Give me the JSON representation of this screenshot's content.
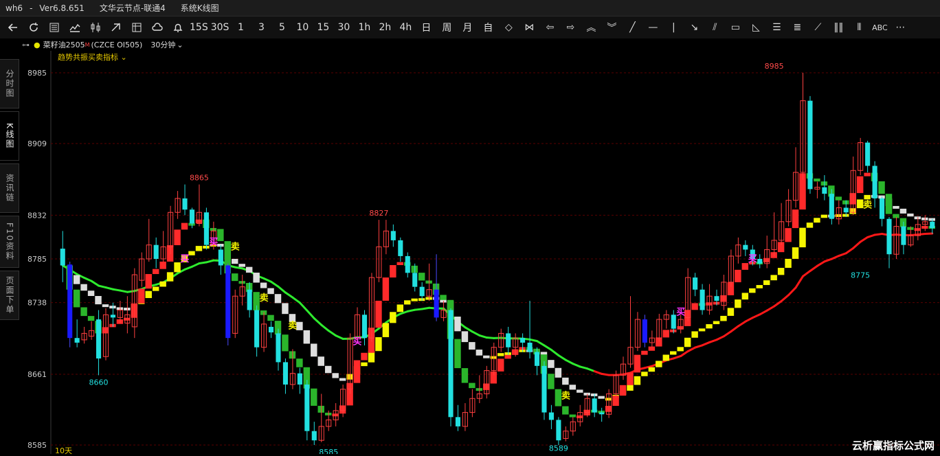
{
  "titlebar": {
    "app": "wh6",
    "sep": "-",
    "version": "Ver6.8.651",
    "node": "文华云节点-联通4",
    "view": "系统K线图"
  },
  "toolbar": {
    "icons": [
      "back-arrow-icon",
      "refresh-icon",
      "table-icon",
      "line-chart-icon",
      "kline-icon",
      "draw-icon",
      "grid-icon",
      "cloud-icon",
      "bell-icon"
    ],
    "periods": [
      "15S",
      "30S",
      "1",
      "3",
      "5",
      "10",
      "15",
      "30",
      "1h",
      "2h",
      "4h",
      "日",
      "周",
      "月",
      "自"
    ],
    "tools": [
      "diamond-icon",
      "bowtie-icon",
      "arrow-left-icon",
      "arrow-right-icon",
      "double-up-icon",
      "double-down-icon",
      "slash-line-icon",
      "horizontal-line-icon",
      "vertical-line-icon",
      "arrow-down-right-icon",
      "parallel-lines-icon",
      "rectangle-icon",
      "triangle-icon",
      "fibonacci-icon",
      "gann-icon",
      "zigzag-icon",
      "bars-icon",
      "bars-dashed-icon"
    ],
    "text_tool": "ABC",
    "more": "more-icon"
  },
  "infobar": {
    "symbol": "菜籽油2505",
    "sup": "M",
    "code": "(CZCE OI505)",
    "period": "30分钟"
  },
  "indicator": "趋势共振买卖指标",
  "sidebar": [
    {
      "label": "分时图"
    },
    {
      "label": "K线图"
    },
    {
      "label": "资讯链"
    },
    {
      "label": "F10资料"
    },
    {
      "label": "页面下单"
    }
  ],
  "days_label": "10天",
  "watermark": "云析赢指标公式网",
  "chart_data": {
    "type": "candlestick",
    "ylim": [
      8585,
      8985
    ],
    "yticks": [
      8985,
      8909,
      8832,
      8785,
      8738,
      8661,
      8585
    ],
    "colors": {
      "up": "#ff2a2a",
      "down": "#22e0e0",
      "buy": "#ff33ff",
      "sell": "#f5f500",
      "grid": "#5a0000",
      "green_line": "#2eea2e",
      "red_line": "#ff1818",
      "yellow": "#f5f500",
      "blue": "#1a1aff"
    },
    "annotations": [
      {
        "i": 5,
        "text": "8660",
        "price": 8660,
        "pos": "below"
      },
      {
        "i": 19,
        "text": "8865",
        "price": 8865,
        "pos": "above"
      },
      {
        "i": 37,
        "text": "8585",
        "price": 8585,
        "pos": "below"
      },
      {
        "i": 44,
        "text": "8827",
        "price": 8827,
        "pos": "above"
      },
      {
        "i": 69,
        "text": "8589",
        "price": 8589,
        "pos": "below"
      },
      {
        "i": 99,
        "text": "8985",
        "price": 8985,
        "pos": "above"
      },
      {
        "i": 111,
        "text": "8775",
        "price": 8775,
        "pos": "below"
      }
    ],
    "signals": [
      {
        "i": 17,
        "text": "买",
        "price": 8782,
        "type": "buy"
      },
      {
        "i": 21,
        "text": "买",
        "price": 8800,
        "type": "buy"
      },
      {
        "i": 24,
        "text": "卖",
        "price": 8795,
        "type": "sell"
      },
      {
        "i": 28,
        "text": "卖",
        "price": 8740,
        "type": "sell"
      },
      {
        "i": 32,
        "text": "卖",
        "price": 8710,
        "type": "sell"
      },
      {
        "i": 41,
        "text": "买",
        "price": 8693,
        "type": "buy"
      },
      {
        "i": 70,
        "text": "卖",
        "price": 8635,
        "type": "sell"
      },
      {
        "i": 86,
        "text": "买",
        "price": 8725,
        "type": "buy"
      },
      {
        "i": 96,
        "text": "买",
        "price": 8782,
        "type": "buy"
      },
      {
        "i": 112,
        "text": "卖",
        "price": 8840,
        "type": "sell"
      }
    ],
    "candles": [
      {
        "o": 8796,
        "c": 8778,
        "h": 8815,
        "l": 8760
      },
      {
        "o": 8779,
        "c": 8700,
        "h": 8782,
        "l": 8690,
        "b": 1
      },
      {
        "o": 8700,
        "c": 8695,
        "h": 8720,
        "l": 8690
      },
      {
        "o": 8698,
        "c": 8705,
        "h": 8712,
        "l": 8694
      },
      {
        "o": 8702,
        "c": 8708,
        "h": 8718,
        "l": 8698
      },
      {
        "o": 8720,
        "c": 8678,
        "h": 8730,
        "l": 8660
      },
      {
        "o": 8680,
        "c": 8725,
        "h": 8732,
        "l": 8676
      },
      {
        "o": 8725,
        "c": 8722,
        "h": 8738,
        "l": 8712
      },
      {
        "o": 8722,
        "c": 8730,
        "h": 8740,
        "l": 8716
      },
      {
        "o": 8716,
        "c": 8725,
        "h": 8745,
        "l": 8705
      },
      {
        "o": 8712,
        "c": 8768,
        "h": 8775,
        "l": 8700
      },
      {
        "o": 8762,
        "c": 8785,
        "h": 8792,
        "l": 8755
      },
      {
        "o": 8785,
        "c": 8800,
        "h": 8828,
        "l": 8782
      },
      {
        "o": 8800,
        "c": 8785,
        "h": 8808,
        "l": 8775
      },
      {
        "o": 8785,
        "c": 8798,
        "h": 8815,
        "l": 8782
      },
      {
        "o": 8798,
        "c": 8835,
        "h": 8842,
        "l": 8790
      },
      {
        "o": 8835,
        "c": 8850,
        "h": 8858,
        "l": 8828
      },
      {
        "o": 8850,
        "c": 8838,
        "h": 8865,
        "l": 8832
      },
      {
        "o": 8838,
        "c": 8823,
        "h": 8840,
        "l": 8818
      },
      {
        "o": 8823,
        "c": 8835,
        "h": 8865,
        "l": 8820
      },
      {
        "o": 8835,
        "c": 8800,
        "h": 8840,
        "l": 8795
      },
      {
        "o": 8800,
        "c": 8815,
        "h": 8825,
        "l": 8795
      },
      {
        "o": 8795,
        "c": 8778,
        "h": 8800,
        "l": 8768
      },
      {
        "o": 8778,
        "c": 8700,
        "h": 8780,
        "l": 8692,
        "b": 1
      },
      {
        "o": 8705,
        "c": 8745,
        "h": 8752,
        "l": 8700
      },
      {
        "o": 8745,
        "c": 8755,
        "h": 8768,
        "l": 8735
      },
      {
        "o": 8752,
        "c": 8730,
        "h": 8760,
        "l": 8722
      },
      {
        "o": 8730,
        "c": 8690,
        "h": 8735,
        "l": 8680
      },
      {
        "o": 8690,
        "c": 8715,
        "h": 8728,
        "l": 8685
      },
      {
        "o": 8712,
        "c": 8706,
        "h": 8718,
        "l": 8700
      },
      {
        "o": 8705,
        "c": 8674,
        "h": 8710,
        "l": 8665
      },
      {
        "o": 8674,
        "c": 8650,
        "h": 8678,
        "l": 8640
      },
      {
        "o": 8650,
        "c": 8662,
        "h": 8688,
        "l": 8645
      },
      {
        "o": 8662,
        "c": 8650,
        "h": 8668,
        "l": 8640
      },
      {
        "o": 8650,
        "c": 8600,
        "h": 8655,
        "l": 8590
      },
      {
        "o": 8600,
        "c": 8590,
        "h": 8610,
        "l": 8585
      },
      {
        "o": 8590,
        "c": 8605,
        "h": 8640,
        "l": 8588
      },
      {
        "o": 8605,
        "c": 8612,
        "h": 8622,
        "l": 8600
      },
      {
        "o": 8612,
        "c": 8622,
        "h": 8630,
        "l": 8605
      },
      {
        "o": 8622,
        "c": 8645,
        "h": 8650,
        "l": 8615
      },
      {
        "o": 8645,
        "c": 8700,
        "h": 8705,
        "l": 8640
      },
      {
        "o": 8700,
        "c": 8725,
        "h": 8733,
        "l": 8694
      },
      {
        "o": 8725,
        "c": 8700,
        "h": 8730,
        "l": 8692
      },
      {
        "o": 8700,
        "c": 8765,
        "h": 8770,
        "l": 8696
      },
      {
        "o": 8765,
        "c": 8798,
        "h": 8827,
        "l": 8760
      },
      {
        "o": 8798,
        "c": 8815,
        "h": 8827,
        "l": 8790
      },
      {
        "o": 8815,
        "c": 8805,
        "h": 8822,
        "l": 8798
      },
      {
        "o": 8805,
        "c": 8788,
        "h": 8808,
        "l": 8782
      },
      {
        "o": 8788,
        "c": 8770,
        "h": 8792,
        "l": 8765
      },
      {
        "o": 8770,
        "c": 8755,
        "h": 8780,
        "l": 8750
      },
      {
        "o": 8755,
        "c": 8745,
        "h": 8760,
        "l": 8740
      },
      {
        "o": 8745,
        "c": 8752,
        "h": 8780,
        "l": 8740
      },
      {
        "o": 8752,
        "c": 8722,
        "h": 8790,
        "l": 8718,
        "b": 1
      },
      {
        "o": 8722,
        "c": 8730,
        "h": 8740,
        "l": 8718
      },
      {
        "o": 8730,
        "c": 8615,
        "h": 8732,
        "l": 8605
      },
      {
        "o": 8615,
        "c": 8605,
        "h": 8628,
        "l": 8600
      },
      {
        "o": 8605,
        "c": 8620,
        "h": 8630,
        "l": 8600
      },
      {
        "o": 8620,
        "c": 8635,
        "h": 8645,
        "l": 8615
      },
      {
        "o": 8635,
        "c": 8640,
        "h": 8660,
        "l": 8630
      },
      {
        "o": 8640,
        "c": 8665,
        "h": 8670,
        "l": 8635
      },
      {
        "o": 8665,
        "c": 8690,
        "h": 8695,
        "l": 8660
      },
      {
        "o": 8690,
        "c": 8705,
        "h": 8710,
        "l": 8685
      },
      {
        "o": 8705,
        "c": 8690,
        "h": 8712,
        "l": 8682
      },
      {
        "o": 8690,
        "c": 8700,
        "h": 8705,
        "l": 8680
      },
      {
        "o": 8700,
        "c": 8695,
        "h": 8705,
        "l": 8685
      },
      {
        "o": 8695,
        "c": 8685,
        "h": 8740,
        "l": 8678
      },
      {
        "o": 8685,
        "c": 8670,
        "h": 8690,
        "l": 8660
      },
      {
        "o": 8670,
        "c": 8620,
        "h": 8675,
        "l": 8612
      },
      {
        "o": 8620,
        "c": 8612,
        "h": 8628,
        "l": 8602
      },
      {
        "o": 8612,
        "c": 8590,
        "h": 8615,
        "l": 8585
      },
      {
        "o": 8592,
        "c": 8600,
        "h": 8605,
        "l": 8589
      },
      {
        "o": 8600,
        "c": 8610,
        "h": 8615,
        "l": 8595
      },
      {
        "o": 8610,
        "c": 8620,
        "h": 8628,
        "l": 8605
      },
      {
        "o": 8620,
        "c": 8635,
        "h": 8640,
        "l": 8615
      },
      {
        "o": 8635,
        "c": 8620,
        "h": 8640,
        "l": 8615
      },
      {
        "o": 8620,
        "c": 8618,
        "h": 8625,
        "l": 8610
      },
      {
        "o": 8618,
        "c": 8640,
        "h": 8645,
        "l": 8614
      },
      {
        "o": 8640,
        "c": 8660,
        "h": 8665,
        "l": 8636
      },
      {
        "o": 8660,
        "c": 8672,
        "h": 8680,
        "l": 8655
      },
      {
        "o": 8672,
        "c": 8690,
        "h": 8745,
        "l": 8668
      },
      {
        "o": 8690,
        "c": 8720,
        "h": 8728,
        "l": 8686
      },
      {
        "o": 8720,
        "c": 8695,
        "h": 8725,
        "l": 8690,
        "b": 1
      },
      {
        "o": 8695,
        "c": 8700,
        "h": 8708,
        "l": 8690
      },
      {
        "o": 8700,
        "c": 8720,
        "h": 8726,
        "l": 8696
      },
      {
        "o": 8720,
        "c": 8725,
        "h": 8730,
        "l": 8710
      },
      {
        "o": 8725,
        "c": 8710,
        "h": 8730,
        "l": 8705
      },
      {
        "o": 8710,
        "c": 8720,
        "h": 8725,
        "l": 8705
      },
      {
        "o": 8722,
        "c": 8765,
        "h": 8775,
        "l": 8718
      },
      {
        "o": 8765,
        "c": 8752,
        "h": 8770,
        "l": 8745
      },
      {
        "o": 8752,
        "c": 8730,
        "h": 8758,
        "l": 8725
      },
      {
        "o": 8730,
        "c": 8745,
        "h": 8758,
        "l": 8725
      },
      {
        "o": 8745,
        "c": 8740,
        "h": 8752,
        "l": 8735
      },
      {
        "o": 8735,
        "c": 8760,
        "h": 8768,
        "l": 8730
      },
      {
        "o": 8760,
        "c": 8788,
        "h": 8795,
        "l": 8755
      },
      {
        "o": 8788,
        "c": 8800,
        "h": 8808,
        "l": 8780
      },
      {
        "o": 8800,
        "c": 8795,
        "h": 8805,
        "l": 8788
      },
      {
        "o": 8795,
        "c": 8785,
        "h": 8800,
        "l": 8778
      },
      {
        "o": 8785,
        "c": 8780,
        "h": 8790,
        "l": 8775
      },
      {
        "o": 8780,
        "c": 8795,
        "h": 8810,
        "l": 8775
      },
      {
        "o": 8795,
        "c": 8805,
        "h": 8835,
        "l": 8788
      },
      {
        "o": 8805,
        "c": 8825,
        "h": 8845,
        "l": 8800
      },
      {
        "o": 8825,
        "c": 8848,
        "h": 8860,
        "l": 8820
      },
      {
        "o": 8848,
        "c": 8878,
        "h": 8905,
        "l": 8840
      },
      {
        "o": 8878,
        "c": 8955,
        "h": 8985,
        "l": 8870
      },
      {
        "o": 8955,
        "c": 8860,
        "h": 8960,
        "l": 8855
      },
      {
        "o": 8860,
        "c": 8862,
        "h": 8868,
        "l": 8850
      },
      {
        "o": 8862,
        "c": 8855,
        "h": 8875,
        "l": 8848
      },
      {
        "o": 8855,
        "c": 8828,
        "h": 8860,
        "l": 8822
      },
      {
        "o": 8828,
        "c": 8840,
        "h": 8848,
        "l": 8822
      },
      {
        "o": 8840,
        "c": 8835,
        "h": 8848,
        "l": 8830
      },
      {
        "o": 8835,
        "c": 8880,
        "h": 8895,
        "l": 8832
      },
      {
        "o": 8880,
        "c": 8910,
        "h": 8915,
        "l": 8875
      },
      {
        "o": 8910,
        "c": 8885,
        "h": 8912,
        "l": 8878
      },
      {
        "o": 8885,
        "c": 8850,
        "h": 8890,
        "l": 8840
      },
      {
        "o": 8850,
        "c": 8828,
        "h": 8852,
        "l": 8820
      },
      {
        "o": 8828,
        "c": 8790,
        "h": 8830,
        "l": 8775
      },
      {
        "o": 8790,
        "c": 8820,
        "h": 8830,
        "l": 8785
      },
      {
        "o": 8820,
        "c": 8800,
        "h": 8825,
        "l": 8790
      },
      {
        "o": 8800,
        "c": 8810,
        "h": 8820,
        "l": 8798
      },
      {
        "o": 8810,
        "c": 8822,
        "h": 8830,
        "l": 8805
      },
      {
        "o": 8822,
        "c": 8825,
        "h": 8832,
        "l": 8815
      },
      {
        "o": 8825,
        "c": 8818,
        "h": 8828,
        "l": 8812
      }
    ]
  }
}
